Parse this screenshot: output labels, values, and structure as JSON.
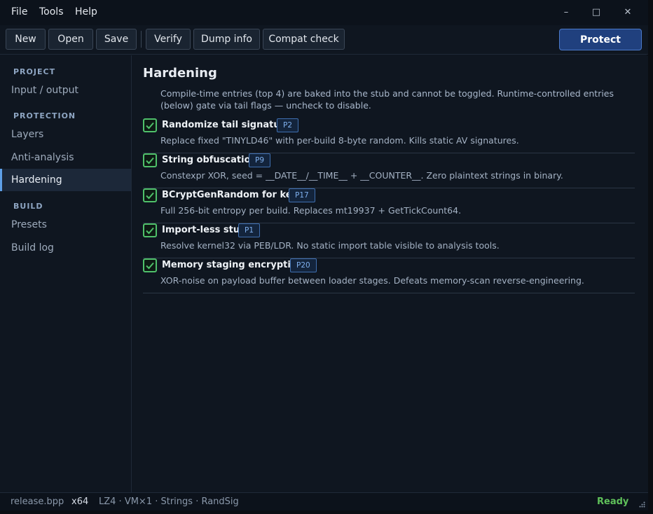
{
  "menu": {
    "items": [
      "File",
      "Tools",
      "Help"
    ]
  },
  "window_controls": {
    "minimize": "–",
    "maximize": "□",
    "close": "✕"
  },
  "toolbar": {
    "new_label": "New",
    "open_label": "Open",
    "save_label": "Save",
    "verify_label": "Verify",
    "dump_info_label": "Dump info",
    "compat_check_label": "Compat check",
    "protect_label": "Protect"
  },
  "sidebar": {
    "sections": [
      {
        "header": "PROJECT",
        "items": [
          "Input / output"
        ]
      },
      {
        "header": "PROTECTION",
        "items": [
          "Layers",
          "Anti-analysis",
          "Hardening"
        ]
      },
      {
        "header": "BUILD",
        "items": [
          "Presets",
          "Build log"
        ]
      }
    ],
    "active_item": "Hardening"
  },
  "main": {
    "title": "Hardening",
    "intro": "Compile-time entries (top 4) are baked into the stub and cannot be toggled. Runtime-controlled entries (below) gate via tail flags — uncheck to disable.",
    "entries": [
      {
        "title": "Randomize tail signature",
        "badge": "P2",
        "checked": true,
        "description": "Replace fixed \"TINYLD46\" with per-build 8-byte random. Kills static AV signatures."
      },
      {
        "title": "String obfuscation",
        "badge": "P9",
        "checked": true,
        "description": "Constexpr XOR, seed = __DATE__/__TIME__ + __COUNTER__. Zero plaintext strings in binary."
      },
      {
        "title": "BCryptGenRandom for keys",
        "badge": "P17",
        "checked": true,
        "description": "Full 256-bit entropy per build. Replaces mt19937 + GetTickCount64."
      },
      {
        "title": "Import-less stub",
        "badge": "P1",
        "checked": true,
        "description": "Resolve kernel32 via PEB/LDR. No static import table visible to analysis tools."
      },
      {
        "title": "Memory staging encryption",
        "badge": "P20",
        "checked": true,
        "description": "XOR-noise on payload buffer between loader stages. Defeats memory-scan reverse-engineering."
      }
    ]
  },
  "statusbar": {
    "file": "release.bpp",
    "arch": "x64",
    "summary": "LZ4 · VM×1 · Strings · RandSig",
    "status": "Ready"
  },
  "colors": {
    "accent": "#20407e",
    "active_indicator": "#5ea0e8",
    "check_green": "#4fc06a",
    "status_ready": "#5fc05a",
    "badge_text": "#7fb0ee"
  }
}
